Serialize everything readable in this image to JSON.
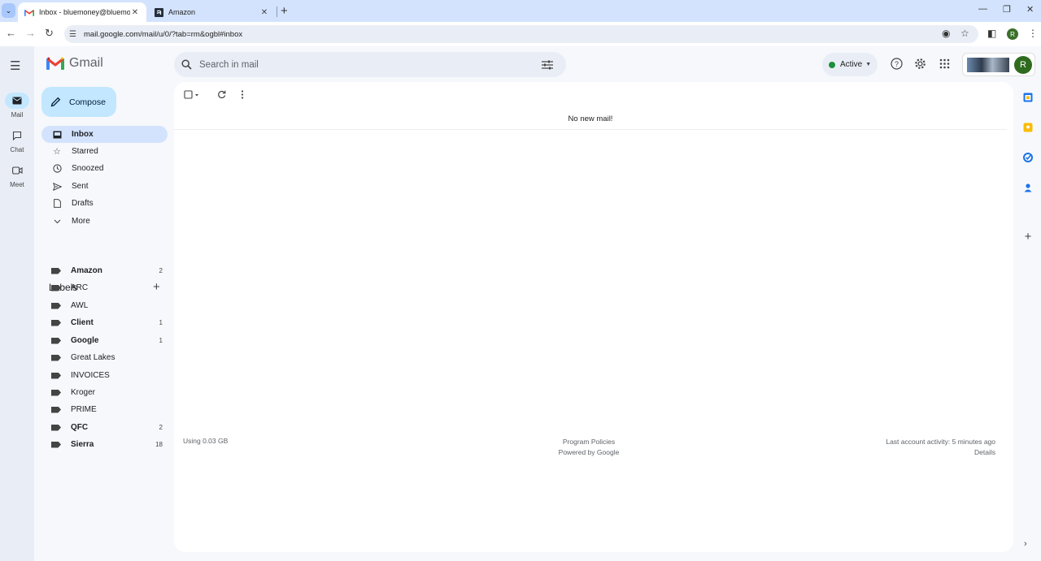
{
  "browser": {
    "tabs": [
      {
        "title": "Inbox - bluemoney@bluemon",
        "active": true,
        "favicon": "gmail-icon"
      },
      {
        "title": "Amazon",
        "active": false,
        "favicon": "amazon-icon"
      }
    ],
    "new_tab": "+",
    "url": "mail.google.com/mail/u/0/?tab=rm&ogbl#inbox",
    "profile_initial": "R"
  },
  "gmail": {
    "product_name": "Gmail",
    "search": {
      "placeholder": "Search in mail"
    },
    "status": {
      "label": "Active",
      "color": "#1e8e3e"
    },
    "account_initial": "R",
    "rail": [
      {
        "label": "Mail",
        "icon": "mail-icon",
        "active": true
      },
      {
        "label": "Chat",
        "icon": "chat-icon",
        "active": false
      },
      {
        "label": "Meet",
        "icon": "meet-icon",
        "active": false
      }
    ],
    "compose_label": "Compose",
    "nav": [
      {
        "label": "Inbox",
        "icon": "inbox-icon",
        "active": true
      },
      {
        "label": "Starred",
        "icon": "star-icon",
        "active": false
      },
      {
        "label": "Snoozed",
        "icon": "clock-icon",
        "active": false
      },
      {
        "label": "Sent",
        "icon": "send-icon",
        "active": false
      },
      {
        "label": "Drafts",
        "icon": "draft-icon",
        "active": false
      },
      {
        "label": "More",
        "icon": "chevron-down-icon",
        "active": false
      }
    ],
    "labels_heading": "Labels",
    "labels": [
      {
        "name": "Amazon",
        "count": "2",
        "bold": true
      },
      {
        "name": "ARC",
        "count": "",
        "bold": false
      },
      {
        "name": "AWL",
        "count": "",
        "bold": false
      },
      {
        "name": "Client",
        "count": "1",
        "bold": true
      },
      {
        "name": "Google",
        "count": "1",
        "bold": true
      },
      {
        "name": "Great Lakes",
        "count": "",
        "bold": false
      },
      {
        "name": "INVOICES",
        "count": "",
        "bold": false
      },
      {
        "name": "Kroger",
        "count": "",
        "bold": false
      },
      {
        "name": "PRIME",
        "count": "",
        "bold": false
      },
      {
        "name": "QFC",
        "count": "2",
        "bold": true
      },
      {
        "name": "Sierra",
        "count": "18",
        "bold": true
      }
    ],
    "main": {
      "empty_message": "No new mail!",
      "storage": "Using 0.03 GB",
      "program_policies": "Program Policies",
      "powered_by": "Powered by Google",
      "last_activity": "Last account activity: 5 minutes ago",
      "details": "Details"
    }
  }
}
